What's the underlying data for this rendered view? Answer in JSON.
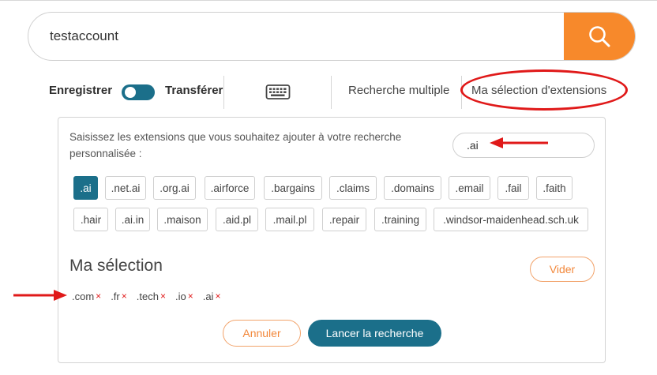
{
  "search": {
    "value": "testaccount",
    "button_icon": "search-icon"
  },
  "toolbar": {
    "register_label": "Enregistrer",
    "transfer_label": "Transférer",
    "toggle_state": "on",
    "keyboard_icon": "keyboard-icon",
    "multi_search_label": "Recherche multiple",
    "my_selection_label": "Ma sélection d'extensions"
  },
  "panel": {
    "description": "Saisissez les extensions que vous souhaitez ajouter à votre recherche personnalisée :",
    "extension_input_value": ".ai",
    "extensions": [
      ".ai",
      ".net.ai",
      ".org.ai",
      ".airforce",
      ".bargains",
      ".claims",
      ".domains",
      ".email",
      ".fail",
      ".faith",
      ".hair",
      ".ai.in",
      ".maison",
      ".aid.pl",
      ".mail.pl",
      ".repair",
      ".training",
      ".windsor-maidenhead.sch.uk"
    ],
    "active_extension": ".ai",
    "selection_title": "Ma sélection",
    "clear_label": "Vider",
    "selected": [
      ".com",
      ".fr",
      ".tech",
      ".io",
      ".ai"
    ],
    "remove_glyph": "×",
    "cancel_label": "Annuler",
    "launch_label": "Lancer la recherche"
  },
  "colors": {
    "accent_orange": "#f7892b",
    "accent_teal": "#1b6f8a",
    "annotation_red": "#e01919"
  }
}
